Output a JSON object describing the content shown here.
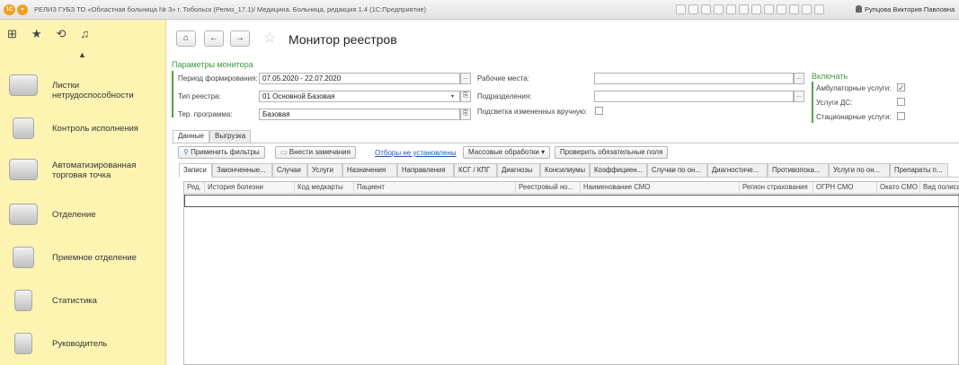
{
  "titlebar": {
    "logo": "1С",
    "menu": "▾",
    "title": "РЕЛИЗ ГУБЗ ТО «Областная больница № 3» г. Тобольск (Релиз_17.1)/ Медицина. Больница, редакция 1.4 (1С:Предприятие)",
    "user": "Рупцова Виктория Павловна"
  },
  "sidebar": {
    "items": [
      {
        "label": "Листки нетрудоспособности",
        "icon": "sick-leave-icon"
      },
      {
        "label": "Контроль исполнения",
        "icon": "medical-kit-icon"
      },
      {
        "label": "Автоматизированная торговая точка",
        "icon": "cash-register-icon"
      },
      {
        "label": "Отделение",
        "icon": "hospital-bed-icon"
      },
      {
        "label": "Приемное отделение",
        "icon": "doctor-icon"
      },
      {
        "label": "Статистика",
        "icon": "clipboard-icon"
      },
      {
        "label": "Руководитель",
        "icon": "manager-icon"
      }
    ]
  },
  "header": {
    "home": "⌂",
    "back": "←",
    "forward": "→",
    "star": "☆",
    "title": "Монитор реестров"
  },
  "params": {
    "section_title": "Параметры монитора",
    "period_label": "Период формирования:",
    "period_value": "07.05.2020 - 22.07.2020",
    "type_label": "Тип реестра:",
    "type_value": "01 Основной Базовая",
    "program_label": "Тер. программа:",
    "program_value": "Базовая",
    "workplaces_label": "Рабочие места:",
    "workplaces_value": "",
    "divisions_label": "Подразделения:",
    "divisions_value": "",
    "highlight_label": "Подсветка измененных вручную:",
    "ellipsis": "...",
    "copy": "⎘",
    "dropdown": "▾"
  },
  "include": {
    "title": "Включать",
    "items": [
      {
        "label": "Амбулаторные услуги:",
        "checked": true
      },
      {
        "label": "Услуги ДС:",
        "checked": false
      },
      {
        "label": "Стационарные услуги:",
        "checked": false
      }
    ],
    "checkmark": "✓"
  },
  "tabs": [
    {
      "label": "Данные",
      "active": true
    },
    {
      "label": "Выгрузка",
      "active": false
    }
  ],
  "toolbar": {
    "apply_filters": "Применить фильтры",
    "add_remarks": "Внести замечания",
    "filters_link": "Отборы не установлены",
    "mass_processing": "Массовые обработки",
    "mass_arrow": "▾",
    "check_fields": "Проверить обязательные поля"
  },
  "subtabs": [
    "Записи",
    "Законченные...",
    "Случаи",
    "Услуги",
    "Назначения",
    "Направления",
    "КСГ / КПГ",
    "Диагнозы",
    "Консилиумы",
    "Коэффициен...",
    "Случаи по он...",
    "Диагностиче...",
    "Противопока...",
    "Услуги по он...",
    "Препараты п..."
  ],
  "grid": {
    "columns": [
      "Ред.",
      "История болезни",
      "Код медкарты",
      "Пациент",
      "Реестровый но...",
      "Наименование СМО",
      "Регион страхования",
      "ОГРН СМО",
      "Окато СМО",
      "Вид полиса"
    ]
  }
}
